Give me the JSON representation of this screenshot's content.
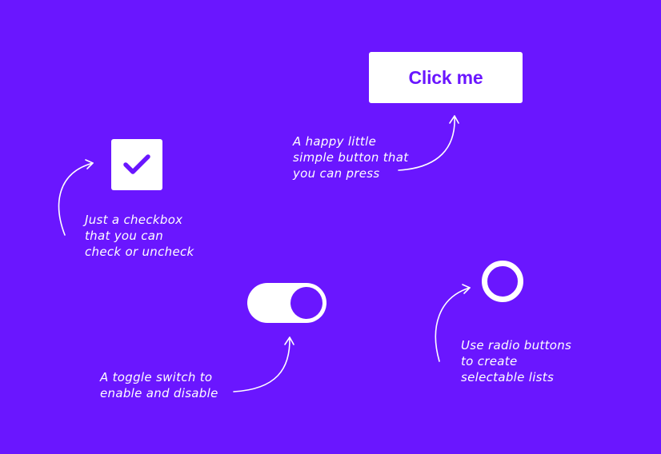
{
  "colors": {
    "background": "#6a16ff",
    "surface": "#ffffff",
    "accent": "#6a16ff"
  },
  "button": {
    "label": "Click me",
    "note": [
      "A happy little",
      "simple button that",
      "you can press"
    ]
  },
  "checkbox": {
    "checked": true,
    "icon": "check-icon",
    "note": [
      "Just a checkbox",
      "that you can",
      "check or uncheck"
    ]
  },
  "toggle": {
    "on": true,
    "note": [
      "A toggle switch to",
      "enable and disable"
    ]
  },
  "radio": {
    "selected": false,
    "note": [
      "Use radio buttons",
      "to create",
      "selectable lists"
    ]
  }
}
